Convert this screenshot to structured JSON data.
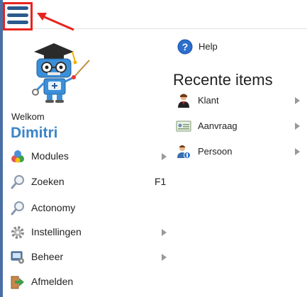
{
  "help": {
    "label": "Help"
  },
  "user": {
    "greeting": "Welkom",
    "name": "Dimitri"
  },
  "menu": {
    "items": [
      {
        "label": "Modules",
        "shortcut": "",
        "icon": "modules-icon",
        "submenu": true
      },
      {
        "label": "Zoeken",
        "shortcut": "F1",
        "icon": "search-icon",
        "submenu": false
      },
      {
        "label": "Actonomy",
        "shortcut": "",
        "icon": "search-icon",
        "submenu": false
      },
      {
        "label": "Instellingen",
        "shortcut": "",
        "icon": "gear-icon",
        "submenu": true
      },
      {
        "label": "Beheer",
        "shortcut": "",
        "icon": "admin-icon",
        "submenu": true
      },
      {
        "label": "Afmelden",
        "shortcut": "",
        "icon": "logout-icon",
        "submenu": false
      }
    ]
  },
  "recent": {
    "title": "Recente items",
    "items": [
      {
        "label": "Klant",
        "icon": "person-icon"
      },
      {
        "label": "Aanvraag",
        "icon": "card-icon"
      },
      {
        "label": "Persoon",
        "icon": "person-badge-icon"
      }
    ]
  },
  "colors": {
    "accent": "#3a85c9",
    "highlight": "#e8231d",
    "hamburger": "#2b5a8d"
  }
}
